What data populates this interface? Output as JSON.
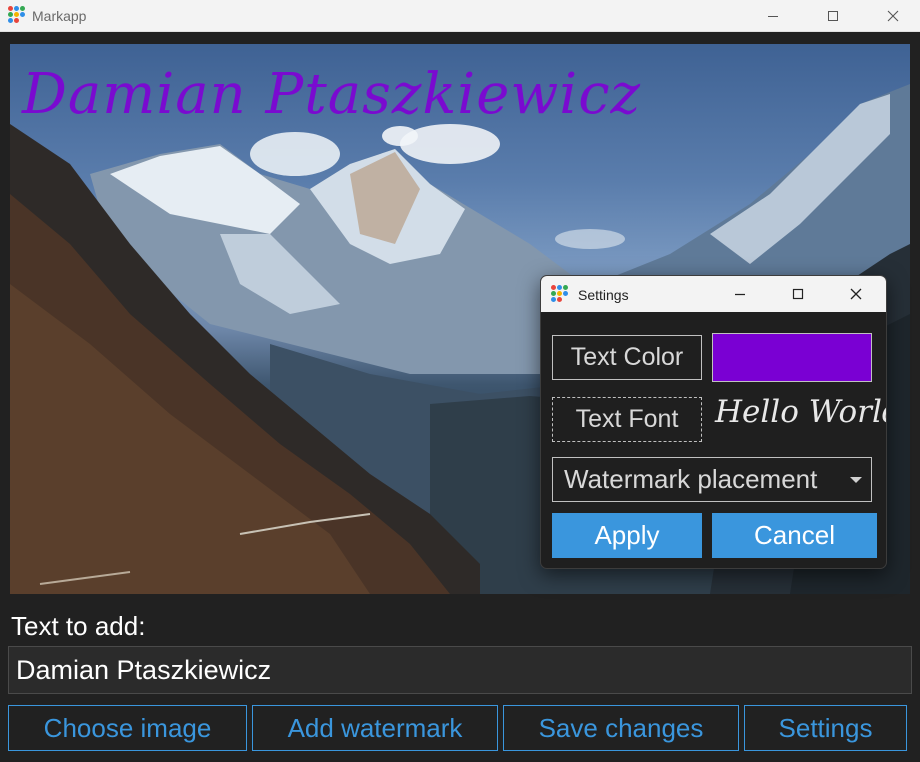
{
  "window": {
    "title": "Markapp",
    "icon": "markapp-logo-icon",
    "controls": [
      "minimize-icon",
      "maximize-icon",
      "close-icon"
    ]
  },
  "image": {
    "watermark_text": "Damian Ptaszkiewicz",
    "watermark_color": "#7a0ad0"
  },
  "form": {
    "text_label": "Text to add:",
    "text_value": "Damian Ptaszkiewicz"
  },
  "actions": {
    "choose_image": "Choose image",
    "add_watermark": "Add watermark",
    "save_changes": "Save changes",
    "settings": "Settings"
  },
  "settings_dialog": {
    "title": "Settings",
    "text_color_label": "Text Color",
    "text_color_value": "#7a00d3",
    "text_font_label": "Text Font",
    "font_preview": "Hello World!",
    "placement_selected": "Watermark placement",
    "apply_label": "Apply",
    "cancel_label": "Cancel"
  },
  "colors": {
    "accent": "#3a96dd",
    "background": "#212121",
    "titlebar": "#f3f3f3"
  }
}
